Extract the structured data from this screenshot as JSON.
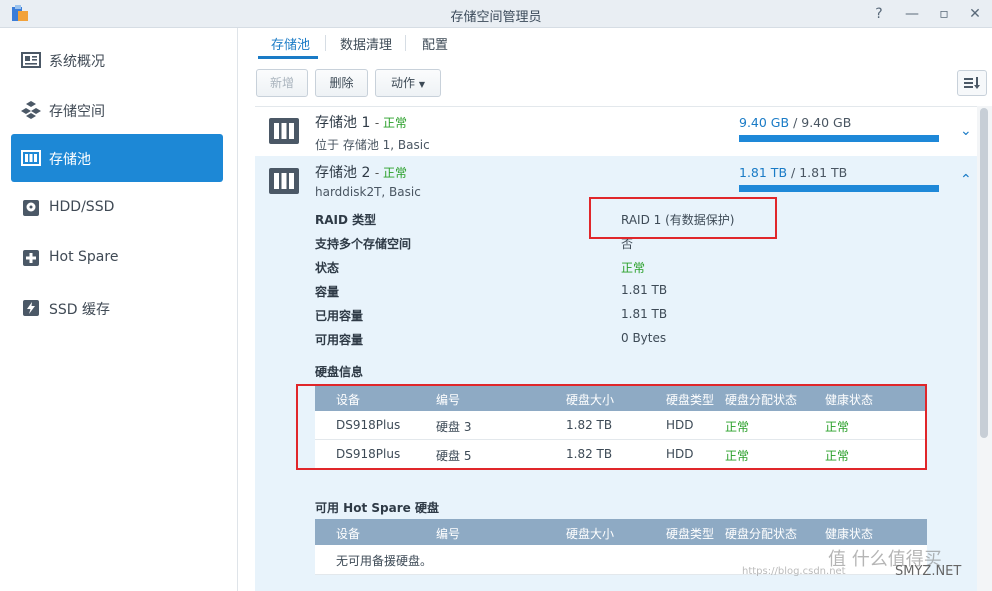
{
  "window": {
    "title": "存储空间管理员"
  },
  "sidebar": {
    "items": [
      {
        "label": "系统概况",
        "icon": "overview-icon"
      },
      {
        "label": "存储空间",
        "icon": "cubes-icon"
      },
      {
        "label": "存储池",
        "icon": "storage-pool-icon",
        "active": true
      },
      {
        "label": "HDD/SSD",
        "icon": "hdd-icon"
      },
      {
        "label": "Hot Spare",
        "icon": "hot-spare-icon"
      },
      {
        "label": "SSD 缓存",
        "icon": "ssd-cache-icon"
      }
    ]
  },
  "tabs": [
    {
      "label": "存储池",
      "active": true
    },
    {
      "label": "数据清理"
    },
    {
      "label": "配置"
    }
  ],
  "toolbar": {
    "create": "新增",
    "delete": "删除",
    "action": "动作"
  },
  "pools": [
    {
      "name": "存储池 1",
      "status": "正常",
      "sub": "位于 存储池 1, Basic",
      "used": "9.40 GB",
      "total": "9.40 GB",
      "expanded": false
    },
    {
      "name": "存储池 2",
      "status": "正常",
      "sub": "harddisk2T, Basic",
      "used": "1.81 TB",
      "total": "1.81 TB",
      "expanded": true,
      "details": [
        {
          "label": "RAID 类型",
          "value": "RAID 1 (有数据保护)"
        },
        {
          "label": "支持多个存储空间",
          "value": "否"
        },
        {
          "label": "状态",
          "value": "正常"
        },
        {
          "label": "容量",
          "value": "1.81 TB"
        },
        {
          "label": "已用容量",
          "value": "1.81 TB"
        },
        {
          "label": "可用容量",
          "value": "0 Bytes"
        }
      ],
      "disk_section": "硬盘信息",
      "columns": [
        "设备",
        "编号",
        "硬盘大小",
        "硬盘类型",
        "硬盘分配状态",
        "健康状态"
      ],
      "disks": [
        [
          "DS918Plus",
          "硬盘 3",
          "1.82 TB",
          "HDD",
          "正常",
          "正常"
        ],
        [
          "DS918Plus",
          "硬盘 5",
          "1.82 TB",
          "HDD",
          "正常",
          "正常"
        ]
      ],
      "spare_section": "可用 Hot Spare 硬盘",
      "spare_empty": "无可用备援硬盘。"
    }
  ],
  "watermark": {
    "text": "值 什么值得买",
    "site": "SMYZ.NET",
    "url": "https://blog.csdn.net"
  },
  "colors": {
    "accent": "#1d88d6",
    "ok": "#2aa02a",
    "highlight": "#e0262a",
    "table_head": "#8eaac4"
  }
}
